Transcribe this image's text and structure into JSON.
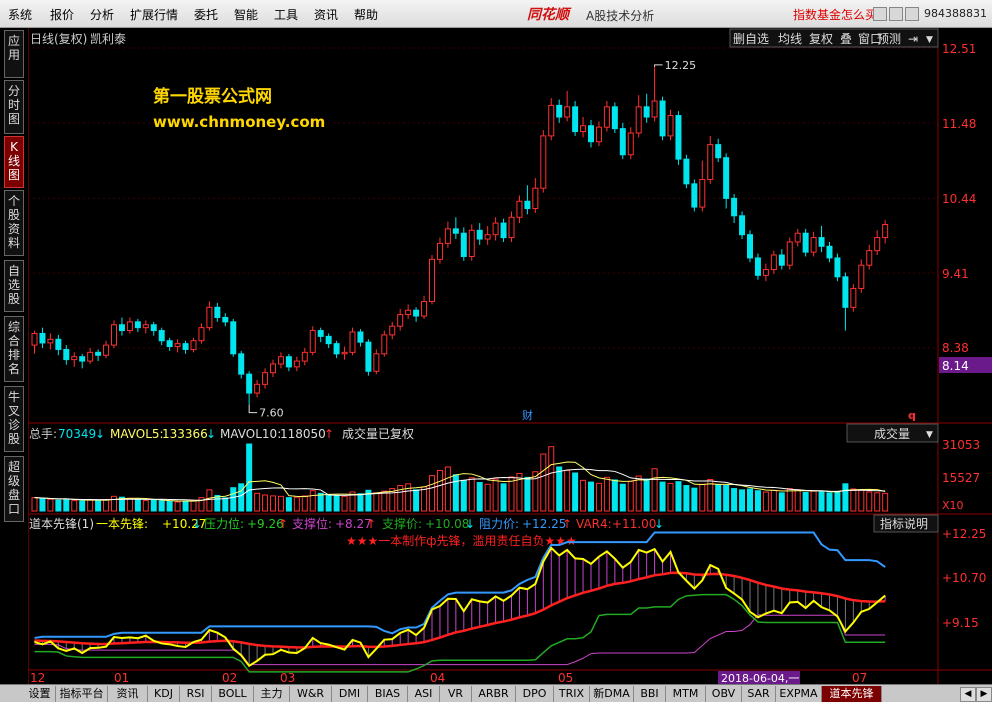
{
  "menu": [
    "系统",
    "报价",
    "分析",
    "扩展行情",
    "委托",
    "智能",
    "工具",
    "资讯",
    "帮助"
  ],
  "brand": "同花顺",
  "app_subtitle": "A股技术分析",
  "ad_text": "指数基金怎么买?",
  "phone": "984388831",
  "sidebar": [
    {
      "label": "应用",
      "active": false
    },
    {
      "label": "分时图",
      "active": false
    },
    {
      "label": "K线图",
      "active": true
    },
    {
      "label": "个股资料",
      "active": false
    },
    {
      "label": "自选股",
      "active": false
    },
    {
      "label": "综合排名",
      "active": false
    },
    {
      "label": "牛叉诊股",
      "active": false
    },
    {
      "label": "超级盘口",
      "active": false
    }
  ],
  "chart_header": {
    "title": "日线(复权)",
    "stock": "凯利泰"
  },
  "toolbar": [
    "删自选",
    "均线",
    "复权",
    "叠",
    "窗口",
    "预测"
  ],
  "watermark": {
    "line1": "第一股票公式网",
    "line2": "www.chnmoney.com"
  },
  "price_axis": {
    "ticks": [
      "12.51",
      "11.48",
      "10.44",
      "9.41",
      "8.38"
    ],
    "current": "8.14"
  },
  "price_annotations": {
    "high": "12.25",
    "low": "7.60",
    "cai": "财",
    "q": "q"
  },
  "volume_header": {
    "total_label": "总手:",
    "total": "70349",
    "mavol5_label": "MAVOL5:",
    "mavol5": "133366",
    "mavol10_label": "MAVOL10:",
    "mavol10": "118050",
    "note": "成交量已复权",
    "selector": "成交量"
  },
  "volume_axis": {
    "ticks": [
      "31053",
      "15527"
    ],
    "unit": "X10"
  },
  "indicator_header": {
    "name": "道本先锋(1)",
    "s1_label": "一本先锋:",
    "s1": "+10.27",
    "s2_label": "压力位:",
    "s2": "+9.26",
    "s3_label": "支撑位:",
    "s3": "+8.27",
    "s4_label": "支撑价:",
    "s4": "+10.08",
    "s5_label": "阻力价:",
    "s5": "+12.25",
    "s6_label": "VAR4:",
    "s6": "+11.00",
    "button": "指标说明"
  },
  "indicator_notice": "★★★一本制作ф先锋，滥用责任自负★★★",
  "indicator_axis": {
    "ticks": [
      "+12.25",
      "+10.70",
      "+9.15"
    ]
  },
  "date_axis": {
    "labels": [
      "12",
      "01",
      "02",
      "03",
      "04",
      "05",
      "07"
    ],
    "cursor": "2018-06-04,一"
  },
  "bottom_tabs": [
    "设置",
    "指标平台",
    "资讯",
    "KDJ",
    "RSI",
    "BOLL",
    "主力",
    "W&R",
    "DMI",
    "BIAS",
    "ASI",
    "VR",
    "ARBR",
    "DPO",
    "TRIX",
    "新DMA",
    "BBI",
    "MTM",
    "OBV",
    "SAR",
    "EXPMA",
    "道本先锋"
  ],
  "active_tab": "道本先锋",
  "colors": {
    "up": "#ff3030",
    "down": "#00e5ee",
    "axis": "#8b0000",
    "yellow": "#ffff00",
    "blue": "#3399ff",
    "green": "#22aa22",
    "red_line": "#ff2020",
    "magenta": "#cc44cc"
  },
  "chart_data": {
    "type": "candlestick",
    "ylim": [
      7.3,
      12.8
    ],
    "candles": [
      [
        8.42,
        8.58,
        8.3,
        8.62
      ],
      [
        8.58,
        8.45,
        8.38,
        8.66
      ],
      [
        8.45,
        8.5,
        8.36,
        8.58
      ],
      [
        8.5,
        8.36,
        8.28,
        8.56
      ],
      [
        8.36,
        8.22,
        8.15,
        8.42
      ],
      [
        8.22,
        8.26,
        8.12,
        8.32
      ],
      [
        8.26,
        8.2,
        8.1,
        8.3
      ],
      [
        8.2,
        8.32,
        8.16,
        8.38
      ],
      [
        8.32,
        8.28,
        8.2,
        8.36
      ],
      [
        8.28,
        8.42,
        8.24,
        8.48
      ],
      [
        8.42,
        8.7,
        8.38,
        8.76
      ],
      [
        8.7,
        8.62,
        8.55,
        8.8
      ],
      [
        8.62,
        8.74,
        8.58,
        8.8
      ],
      [
        8.74,
        8.66,
        8.6,
        8.78
      ],
      [
        8.66,
        8.7,
        8.58,
        8.76
      ],
      [
        8.7,
        8.62,
        8.55,
        8.74
      ],
      [
        8.62,
        8.48,
        8.42,
        8.66
      ],
      [
        8.48,
        8.4,
        8.34,
        8.52
      ],
      [
        8.4,
        8.44,
        8.32,
        8.5
      ],
      [
        8.44,
        8.36,
        8.3,
        8.48
      ],
      [
        8.36,
        8.48,
        8.32,
        8.52
      ],
      [
        8.48,
        8.66,
        8.44,
        8.72
      ],
      [
        8.66,
        8.94,
        8.62,
        9.02
      ],
      [
        8.94,
        8.8,
        8.74,
        9.0
      ],
      [
        8.8,
        8.74,
        8.68,
        8.86
      ],
      [
        8.74,
        8.3,
        8.26,
        8.78
      ],
      [
        8.3,
        8.02,
        7.96,
        8.34
      ],
      [
        8.02,
        7.76,
        7.6,
        8.06
      ],
      [
        7.76,
        7.88,
        7.7,
        7.94
      ],
      [
        7.88,
        8.04,
        7.82,
        8.1
      ],
      [
        8.04,
        8.16,
        7.98,
        8.22
      ],
      [
        8.16,
        8.26,
        8.1,
        8.32
      ],
      [
        8.26,
        8.12,
        8.06,
        8.3
      ],
      [
        8.12,
        8.2,
        8.06,
        8.26
      ],
      [
        8.2,
        8.32,
        8.14,
        8.38
      ],
      [
        8.32,
        8.62,
        8.28,
        8.68
      ],
      [
        8.62,
        8.54,
        8.46,
        8.66
      ],
      [
        8.54,
        8.44,
        8.38,
        8.58
      ],
      [
        8.44,
        8.3,
        8.24,
        8.48
      ],
      [
        8.3,
        8.32,
        8.22,
        8.4
      ],
      [
        8.32,
        8.6,
        8.28,
        8.66
      ],
      [
        8.6,
        8.46,
        8.4,
        8.64
      ],
      [
        8.46,
        8.06,
        8.0,
        8.5
      ],
      [
        8.06,
        8.3,
        8.02,
        8.36
      ],
      [
        8.3,
        8.56,
        8.26,
        8.62
      ],
      [
        8.56,
        8.68,
        8.5,
        8.74
      ],
      [
        8.68,
        8.84,
        8.62,
        8.92
      ],
      [
        8.84,
        8.9,
        8.78,
        8.98
      ],
      [
        8.9,
        8.82,
        8.74,
        8.94
      ],
      [
        8.82,
        9.02,
        8.78,
        9.1
      ],
      [
        9.02,
        9.6,
        8.98,
        9.66
      ],
      [
        9.6,
        9.82,
        9.54,
        9.9
      ],
      [
        9.82,
        10.02,
        9.76,
        10.12
      ],
      [
        10.02,
        9.96,
        9.88,
        10.18
      ],
      [
        9.96,
        9.64,
        9.58,
        10.04
      ],
      [
        9.64,
        10.0,
        9.58,
        10.08
      ],
      [
        10.0,
        9.88,
        9.8,
        10.1
      ],
      [
        9.88,
        9.94,
        9.8,
        10.06
      ],
      [
        9.94,
        10.1,
        9.86,
        10.18
      ],
      [
        10.1,
        9.9,
        9.84,
        10.16
      ],
      [
        9.9,
        10.18,
        9.84,
        10.26
      ],
      [
        10.18,
        10.4,
        10.1,
        10.48
      ],
      [
        10.4,
        10.3,
        10.22,
        10.62
      ],
      [
        10.3,
        10.58,
        10.24,
        10.72
      ],
      [
        10.58,
        11.3,
        10.52,
        11.38
      ],
      [
        11.3,
        11.72,
        11.24,
        11.82
      ],
      [
        11.72,
        11.56,
        11.48,
        11.8
      ],
      [
        11.56,
        11.7,
        11.5,
        11.92
      ],
      [
        11.7,
        11.36,
        11.3,
        11.78
      ],
      [
        11.36,
        11.44,
        11.28,
        11.56
      ],
      [
        11.44,
        11.22,
        11.14,
        11.52
      ],
      [
        11.22,
        11.42,
        11.16,
        11.5
      ],
      [
        11.42,
        11.7,
        11.36,
        11.78
      ],
      [
        11.7,
        11.4,
        11.34,
        11.76
      ],
      [
        11.4,
        11.04,
        10.98,
        11.48
      ],
      [
        11.04,
        11.34,
        10.98,
        11.42
      ],
      [
        11.34,
        11.7,
        11.28,
        11.86
      ],
      [
        11.7,
        11.56,
        11.48,
        11.88
      ],
      [
        11.56,
        11.78,
        11.5,
        12.25
      ],
      [
        11.78,
        11.3,
        11.24,
        11.84
      ],
      [
        11.3,
        11.58,
        11.24,
        11.66
      ],
      [
        11.58,
        10.98,
        10.9,
        11.64
      ],
      [
        10.98,
        10.64,
        10.58,
        11.04
      ],
      [
        10.64,
        10.32,
        10.26,
        10.7
      ],
      [
        10.32,
        10.7,
        10.26,
        10.96
      ],
      [
        10.7,
        11.18,
        10.64,
        11.3
      ],
      [
        11.18,
        11.0,
        10.94,
        11.26
      ],
      [
        11.0,
        10.44,
        10.3,
        11.06
      ],
      [
        10.44,
        10.2,
        10.1,
        10.5
      ],
      [
        10.2,
        9.94,
        9.88,
        10.26
      ],
      [
        9.94,
        9.62,
        9.56,
        10.0
      ],
      [
        9.62,
        9.38,
        9.32,
        9.68
      ],
      [
        9.38,
        9.46,
        9.3,
        9.54
      ],
      [
        9.46,
        9.66,
        9.4,
        9.72
      ],
      [
        9.66,
        9.52,
        9.46,
        9.74
      ],
      [
        9.52,
        9.84,
        9.46,
        9.9
      ],
      [
        9.84,
        9.96,
        9.78,
        10.02
      ],
      [
        9.96,
        9.7,
        9.64,
        10.02
      ],
      [
        9.7,
        9.9,
        9.64,
        9.98
      ],
      [
        9.9,
        9.78,
        9.7,
        10.06
      ],
      [
        9.78,
        9.62,
        9.56,
        9.84
      ],
      [
        9.62,
        9.36,
        9.3,
        9.68
      ],
      [
        9.36,
        8.94,
        8.62,
        9.42
      ],
      [
        8.94,
        9.2,
        8.88,
        9.26
      ],
      [
        9.2,
        9.52,
        9.14,
        9.6
      ],
      [
        9.52,
        9.72,
        9.46,
        9.8
      ],
      [
        9.72,
        9.9,
        9.66,
        10.0
      ],
      [
        9.9,
        10.08,
        9.82,
        10.14
      ]
    ],
    "volume_ylim": [
      0,
      38000
    ],
    "volumes": [
      6200,
      5800,
      5400,
      5000,
      5600,
      4800,
      4600,
      5200,
      4900,
      5300,
      6800,
      6400,
      5900,
      5200,
      4800,
      5000,
      4700,
      4400,
      4200,
      4600,
      5000,
      6200,
      9800,
      7200,
      6100,
      10800,
      12600,
      31053,
      8200,
      7400,
      7000,
      6800,
      6200,
      6400,
      7000,
      9400,
      8200,
      7600,
      7000,
      6800,
      8800,
      8000,
      9600,
      8400,
      9200,
      10400,
      11800,
      12600,
      9800,
      11200,
      16400,
      18800,
      20400,
      16800,
      14200,
      15400,
      13200,
      12400,
      14800,
      12600,
      15800,
      17400,
      15600,
      18200,
      26400,
      29800,
      20400,
      18800,
      17600,
      14200,
      13400,
      12800,
      15600,
      14400,
      12400,
      13800,
      16200,
      14800,
      19600,
      13400,
      12800,
      13600,
      11800,
      10600,
      12400,
      14600,
      12200,
      11800,
      10400,
      9800,
      10200,
      9400,
      8800,
      9600,
      8400,
      10400,
      9800,
      8600,
      9200,
      8800,
      8400,
      9000,
      12600,
      10200,
      9600,
      8800,
      8400,
      8200
    ],
    "indicator_ylim": [
      7.6,
      12.6
    ]
  }
}
